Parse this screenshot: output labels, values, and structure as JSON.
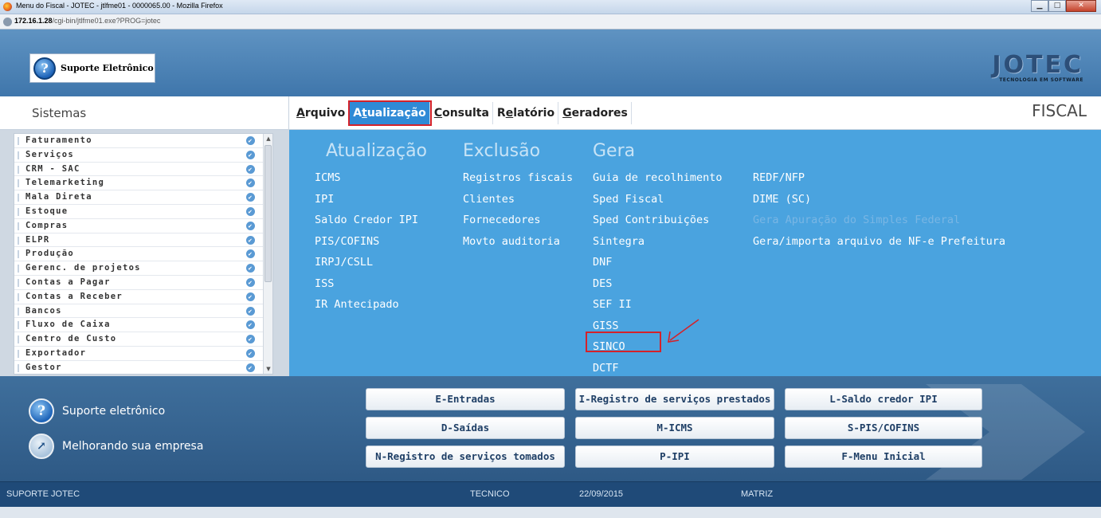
{
  "window": {
    "title": "Menu do Fiscal - JOTEC - jtlfme01 - 0000065.00 - Mozilla Firefox",
    "url_host": "172.16.1.28",
    "url_path": "/cgi-bin/jtlfme01.exe?PROG=jotec"
  },
  "header": {
    "support_logo_text": "Suporte Eletrônico",
    "brand_name": "JOTEC",
    "brand_tagline": "TECNOLOGIA EM SOFTWARE"
  },
  "nav": {
    "sistemas_label": "Sistemas",
    "module_title": "FISCAL",
    "menu": [
      {
        "key": "A",
        "rest": "rquivo",
        "pre": ""
      },
      {
        "key": "t",
        "rest": "ualização",
        "pre": "A"
      },
      {
        "key": "C",
        "rest": "onsulta",
        "pre": ""
      },
      {
        "key": "e",
        "rest": "latório",
        "pre": "R"
      },
      {
        "key": "G",
        "rest": "eradores",
        "pre": ""
      }
    ]
  },
  "sidebar": {
    "items": [
      "Faturamento",
      "Serviços",
      "CRM - SAC",
      "Telemarketing",
      "Mala Direta",
      "Estoque",
      "Compras",
      "ELPR",
      "Produção",
      "Gerenc. de projetos",
      "Contas a Pagar",
      "Contas a Receber",
      "Bancos",
      "Fluxo de Caixa",
      "Centro de Custo",
      "Exportador",
      "Gestor"
    ]
  },
  "dropdown": {
    "col1": {
      "title": "Atualização",
      "items": [
        "ICMS",
        "IPI",
        "Saldo Credor IPI",
        "PIS/COFINS",
        "IRPJ/CSLL",
        "ISS",
        "IR Antecipado"
      ]
    },
    "col2": {
      "title": "Exclusão",
      "items": [
        "Registros fiscais",
        "Clientes",
        "Fornecedores",
        "Movto auditoria"
      ]
    },
    "col3": {
      "title": "Gera",
      "items": [
        "Guia de recolhimento",
        "Sped Fiscal",
        "Sped Contribuições",
        "Sintegra",
        "DNF",
        "DES",
        "SEF II",
        "GISS",
        "SINCO",
        "DCTF"
      ]
    },
    "col4": {
      "items": [
        "REDF/NFP",
        "DIME (SC)",
        "Gera Apuração do Simples Federal",
        "Gera/importa arquivo de NF-e Prefeitura"
      ]
    }
  },
  "bottom": {
    "support_label": "Suporte eletrônico",
    "improve_label": "Melhorando sua empresa",
    "buttons": [
      [
        "E-Entradas",
        "I-Registro de serviços prestados",
        "L-Saldo credor IPI"
      ],
      [
        "D-Saídas",
        "M-ICMS",
        "S-PIS/COFINS"
      ],
      [
        "N-Registro de serviços tomados",
        "P-IPI",
        "F-Menu Inicial"
      ]
    ]
  },
  "status": {
    "company": "SUPORTE JOTEC",
    "user": "TECNICO",
    "date": "22/09/2015",
    "branch": "MATRIZ"
  },
  "colors": {
    "dropdown_bg": "#4aa3df",
    "highlight_red": "#d4222a",
    "active_menu": "#2f8ad6"
  }
}
